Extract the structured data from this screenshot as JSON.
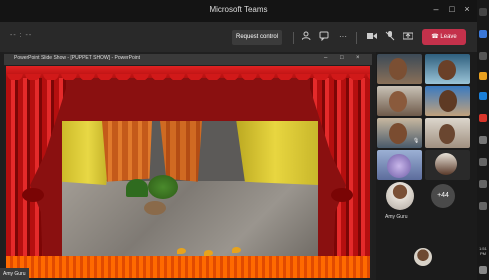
{
  "window": {
    "title": "Microsoft Teams",
    "minimize": "–",
    "maximize": "□",
    "close": "×"
  },
  "toolbar": {
    "timer": "-- : --",
    "request_control": "Request control",
    "more": "···",
    "leave": "Leave"
  },
  "presentation": {
    "title": "PowerPoint Slide Show - [PUPPET SHOW] - PowerPoint",
    "controls": [
      "–",
      "□",
      "×"
    ]
  },
  "participants": {
    "more_badge": "+44",
    "active_name": "Amy Guru"
  },
  "self_view": {
    "label": "Amy Guru"
  },
  "taskbar_clock": "1:51 PM",
  "colors": {
    "leave": "#c4314b",
    "curtain": "#d11919",
    "stage_edge": "#ff6a00",
    "background": "#1f1f1f"
  }
}
